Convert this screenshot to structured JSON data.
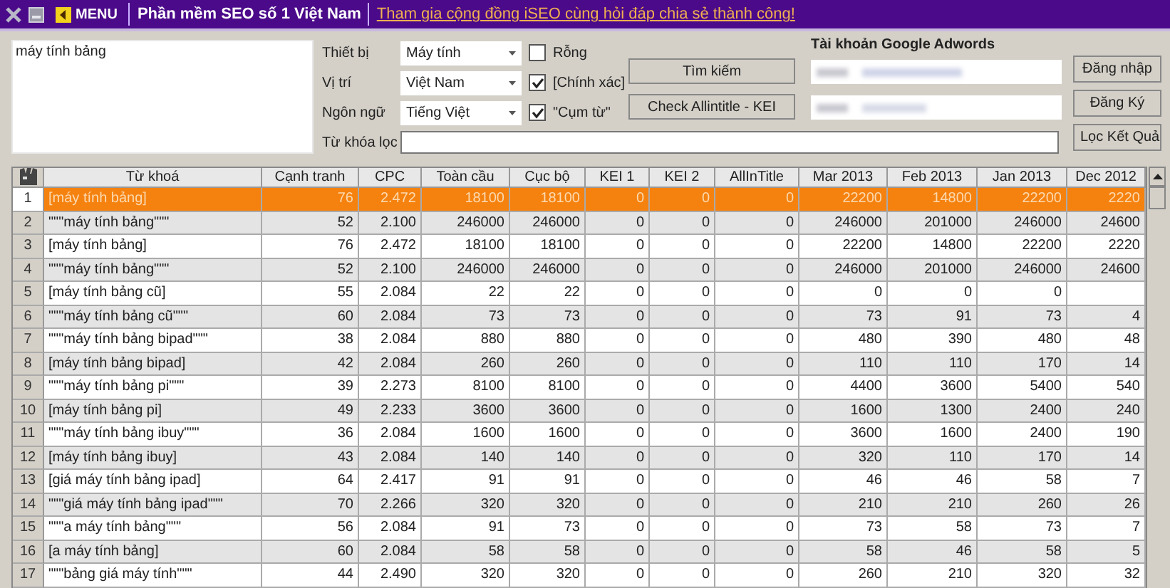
{
  "toolbar": {
    "menu_label": "MENU",
    "app_title": "Phần mềm SEO số 1 Việt Nam",
    "community_link": "Tham gia cộng đồng iSEO cùng hỏi đáp  chia sẻ thành công!"
  },
  "keyword_input": {
    "value": "máy tính bảng"
  },
  "filters": [
    {
      "label": "Thiết bị",
      "value": "Máy tính"
    },
    {
      "label": "Vị trí",
      "value": "Việt Nam"
    },
    {
      "label": "Ngôn ngữ",
      "value": "Tiếng Việt"
    }
  ],
  "options": [
    {
      "label": "Rỗng",
      "checked": false
    },
    {
      "label": "[Chính xác]",
      "checked": true
    },
    {
      "label": "\"Cụm từ\"",
      "checked": true
    }
  ],
  "filter_keyword": {
    "label": "Từ khóa lọc"
  },
  "actions": [
    "Tìm kiếm",
    "Check Allintitle - KEI"
  ],
  "adwords": {
    "title": "Tài khoản Google Adwords",
    "buttons": [
      "Đăng nhập",
      "Đăng Ký"
    ]
  },
  "filter_button": "Lọc Kết Quả",
  "table": {
    "columns": [
      "Từ khoá",
      "Cạnh tranh",
      "CPC",
      "Toàn cầu",
      "Cục bộ",
      "KEI 1",
      "KEI 2",
      "AllInTitle",
      "Mar 2013",
      "Feb 2013",
      "Jan 2013",
      "Dec 2012"
    ],
    "rows": [
      {
        "number": "1",
        "selected": true,
        "cells": [
          "[máy tính bảng]",
          "76",
          "2.472",
          "18100",
          "18100",
          "0",
          "0",
          "0",
          "22200",
          "14800",
          "22200",
          "2220"
        ]
      },
      {
        "number": "2",
        "selected": false,
        "cells": [
          "\"\"\"máy tính bảng\"\"\"",
          "52",
          "2.100",
          "246000",
          "246000",
          "0",
          "0",
          "0",
          "246000",
          "201000",
          "246000",
          "24600"
        ]
      },
      {
        "number": "3",
        "selected": false,
        "cells": [
          "[máy tính bảng]",
          "76",
          "2.472",
          "18100",
          "18100",
          "0",
          "0",
          "0",
          "22200",
          "14800",
          "22200",
          "2220"
        ]
      },
      {
        "number": "4",
        "selected": false,
        "cells": [
          "\"\"\"máy tính bảng\"\"\"",
          "52",
          "2.100",
          "246000",
          "246000",
          "0",
          "0",
          "0",
          "246000",
          "201000",
          "246000",
          "24600"
        ]
      },
      {
        "number": "5",
        "selected": false,
        "cells": [
          "[máy tính bảng cũ]",
          "55",
          "2.084",
          "22",
          "22",
          "0",
          "0",
          "0",
          "0",
          "0",
          "0"
        ]
      },
      {
        "number": "6",
        "selected": false,
        "cells": [
          "\"\"\"máy tính bảng cũ\"\"\"",
          "60",
          "2.084",
          "73",
          "73",
          "0",
          "0",
          "0",
          "73",
          "91",
          "73",
          "4"
        ]
      },
      {
        "number": "7",
        "selected": false,
        "cells": [
          "\"\"\"máy tính bảng bipad\"\"\"",
          "38",
          "2.084",
          "880",
          "880",
          "0",
          "0",
          "0",
          "480",
          "390",
          "480",
          "48"
        ]
      },
      {
        "number": "8",
        "selected": false,
        "cells": [
          "[máy tính bảng bipad]",
          "42",
          "2.084",
          "260",
          "260",
          "0",
          "0",
          "0",
          "110",
          "110",
          "170",
          "14"
        ]
      },
      {
        "number": "9",
        "selected": false,
        "cells": [
          "\"\"\"máy tính bảng pi\"\"\"",
          "39",
          "2.273",
          "8100",
          "8100",
          "0",
          "0",
          "0",
          "4400",
          "3600",
          "5400",
          "540"
        ]
      },
      {
        "number": "10",
        "selected": false,
        "cells": [
          "[máy tính bảng pi]",
          "49",
          "2.233",
          "3600",
          "3600",
          "0",
          "0",
          "0",
          "1600",
          "1300",
          "2400",
          "240"
        ]
      },
      {
        "number": "11",
        "selected": false,
        "cells": [
          "\"\"\"máy tính bảng ibuy\"\"\"",
          "36",
          "2.084",
          "1600",
          "1600",
          "0",
          "0",
          "0",
          "3600",
          "1600",
          "2400",
          "190"
        ]
      },
      {
        "number": "12",
        "selected": false,
        "cells": [
          "[máy tính bảng ibuy]",
          "43",
          "2.084",
          "140",
          "140",
          "0",
          "0",
          "0",
          "320",
          "110",
          "170",
          "14"
        ]
      },
      {
        "number": "13",
        "selected": false,
        "cells": [
          "[giá máy tính bảng ipad]",
          "64",
          "2.417",
          "91",
          "91",
          "0",
          "0",
          "0",
          "46",
          "46",
          "58",
          "7"
        ]
      },
      {
        "number": "14",
        "selected": false,
        "cells": [
          "\"\"\"giá máy tính bảng ipad\"\"\"",
          "70",
          "2.266",
          "320",
          "320",
          "0",
          "0",
          "0",
          "210",
          "210",
          "260",
          "26"
        ]
      },
      {
        "number": "15",
        "selected": false,
        "cells": [
          "\"\"\"a máy tính bảng\"\"\"",
          "56",
          "2.084",
          "91",
          "73",
          "0",
          "0",
          "0",
          "73",
          "58",
          "73",
          "7"
        ]
      },
      {
        "number": "16",
        "selected": false,
        "cells": [
          "[a máy tính bảng]",
          "60",
          "2.084",
          "58",
          "58",
          "0",
          "0",
          "0",
          "58",
          "46",
          "58",
          "5"
        ]
      },
      {
        "number": "17",
        "selected": false,
        "cells": [
          "\"\"\"bảng giá máy tính\"\"\"",
          "44",
          "2.490",
          "320",
          "320",
          "0",
          "0",
          "0",
          "260",
          "210",
          "320",
          "32"
        ]
      }
    ]
  }
}
